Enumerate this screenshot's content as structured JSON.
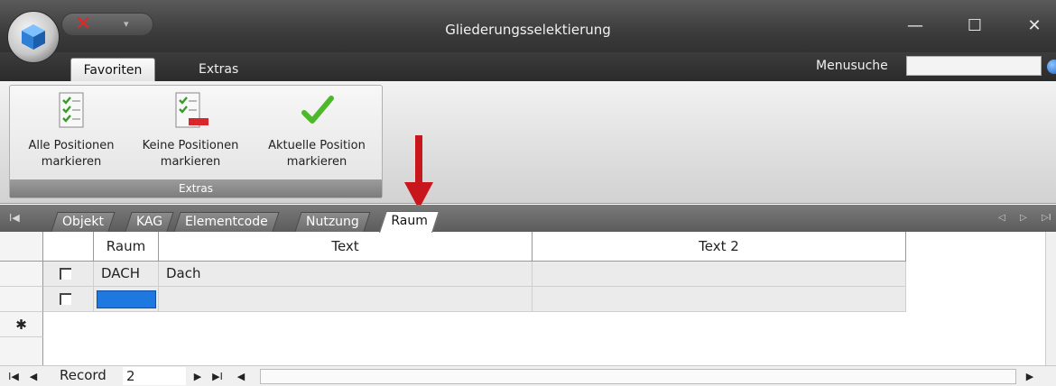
{
  "window": {
    "title": "Gliederungsselektierung",
    "controls": {
      "minimize": "—",
      "maximize": "☐",
      "close": "✕"
    },
    "qat_close_glyph": "✕",
    "qat_dropdown_glyph": "▾"
  },
  "ribbon": {
    "tabs": [
      {
        "label": "Favoriten",
        "active": true
      },
      {
        "label": "Extras",
        "active": false
      }
    ],
    "menu_search_label": "Menusuche",
    "menu_search_value": "",
    "group": {
      "caption": "Extras",
      "buttons": [
        {
          "line1": "Alle Positionen",
          "line2": "markieren",
          "icon": "checklist-all-icon"
        },
        {
          "line1": "Keine Positionen",
          "line2": "markieren",
          "icon": "checklist-none-icon"
        },
        {
          "line1": "Aktuelle Position",
          "line2": "markieren",
          "icon": "green-checkmark-icon"
        }
      ]
    }
  },
  "annotation": {
    "icon": "red-down-arrow",
    "color": "#c8161d"
  },
  "form_tabs": [
    {
      "label": "Objekt",
      "active": false
    },
    {
      "label": "KAG",
      "active": false
    },
    {
      "label": "Elementcode",
      "active": false
    },
    {
      "label": "Nutzung",
      "active": false
    },
    {
      "label": "Raum",
      "active": true
    }
  ],
  "form_tab_nav": {
    "first": "I◀",
    "prev": "◁",
    "next": "▷",
    "last": "▷I"
  },
  "table": {
    "columns": [
      "Raum",
      "Text",
      "Text 2"
    ],
    "rows": [
      {
        "checked": false,
        "raum": "DACH",
        "text": "Dach",
        "text2": ""
      },
      {
        "checked": false,
        "raum": "",
        "text": "",
        "text2": ""
      }
    ],
    "new_row_marker": "✱"
  },
  "navigator": {
    "first": "I◀",
    "prev": "◀",
    "record_label": "Record",
    "record_value": "2",
    "next": "▶",
    "last": "▶I",
    "scroll_left": "◀",
    "scroll_right": "▶"
  }
}
